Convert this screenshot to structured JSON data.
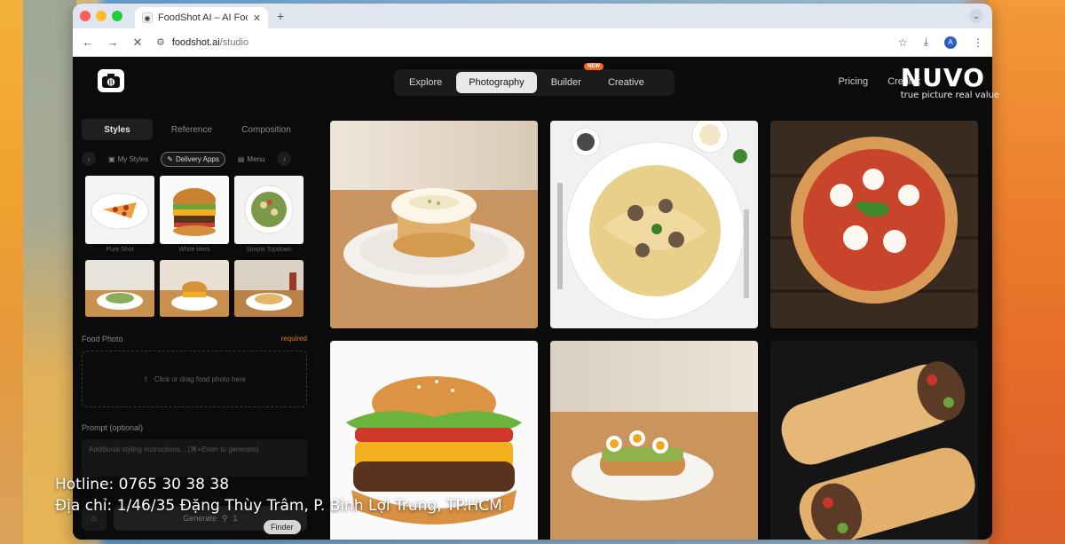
{
  "browser": {
    "tab_title": "FoodShot AI – AI Food Photo",
    "tab_close": "✕",
    "new_tab": "+",
    "url_host": "foodshot.ai",
    "url_path": "/studio",
    "profile_initial": "A"
  },
  "app": {
    "nav_tabs": [
      {
        "label": "Explore",
        "active": false
      },
      {
        "label": "Photography",
        "active": true
      },
      {
        "label": "Builder",
        "active": false,
        "badge": "NEW"
      },
      {
        "label": "Creative",
        "active": false
      }
    ],
    "pricing_label": "Pricing",
    "credits_label": "Credits:",
    "sidebar": {
      "tabs": [
        "Styles",
        "Reference",
        "Composition"
      ],
      "chips": [
        "My Styles",
        "Delivery Apps",
        "Menu"
      ],
      "thumb_captions": [
        "Pure Shot",
        "White Hero",
        "Simple Topdown"
      ],
      "food_photo_label": "Food Photo",
      "required_label": "required",
      "dropzone_text": "Click or drag food photo here",
      "prompt_label": "Prompt (optional)",
      "prompt_placeholder": "Additional styling instructions... (⌘+Enter to generate)",
      "generate_label": "Generate",
      "generate_cost": "1"
    },
    "finder_label": "Finder"
  },
  "watermark": {
    "brand": "NUVO",
    "tagline": "true picture real value"
  },
  "overlay": {
    "hotline": "Hotline: 0765 30 38 38",
    "address": "Địa chỉ: 1/46/35 Đặng Thùy Trâm, P. Bình Lợi Trung, TP.HCM"
  },
  "colors": {
    "accent": "#f36a1f",
    "required": "#e67a1c",
    "app_bg": "#0b0b0c"
  }
}
